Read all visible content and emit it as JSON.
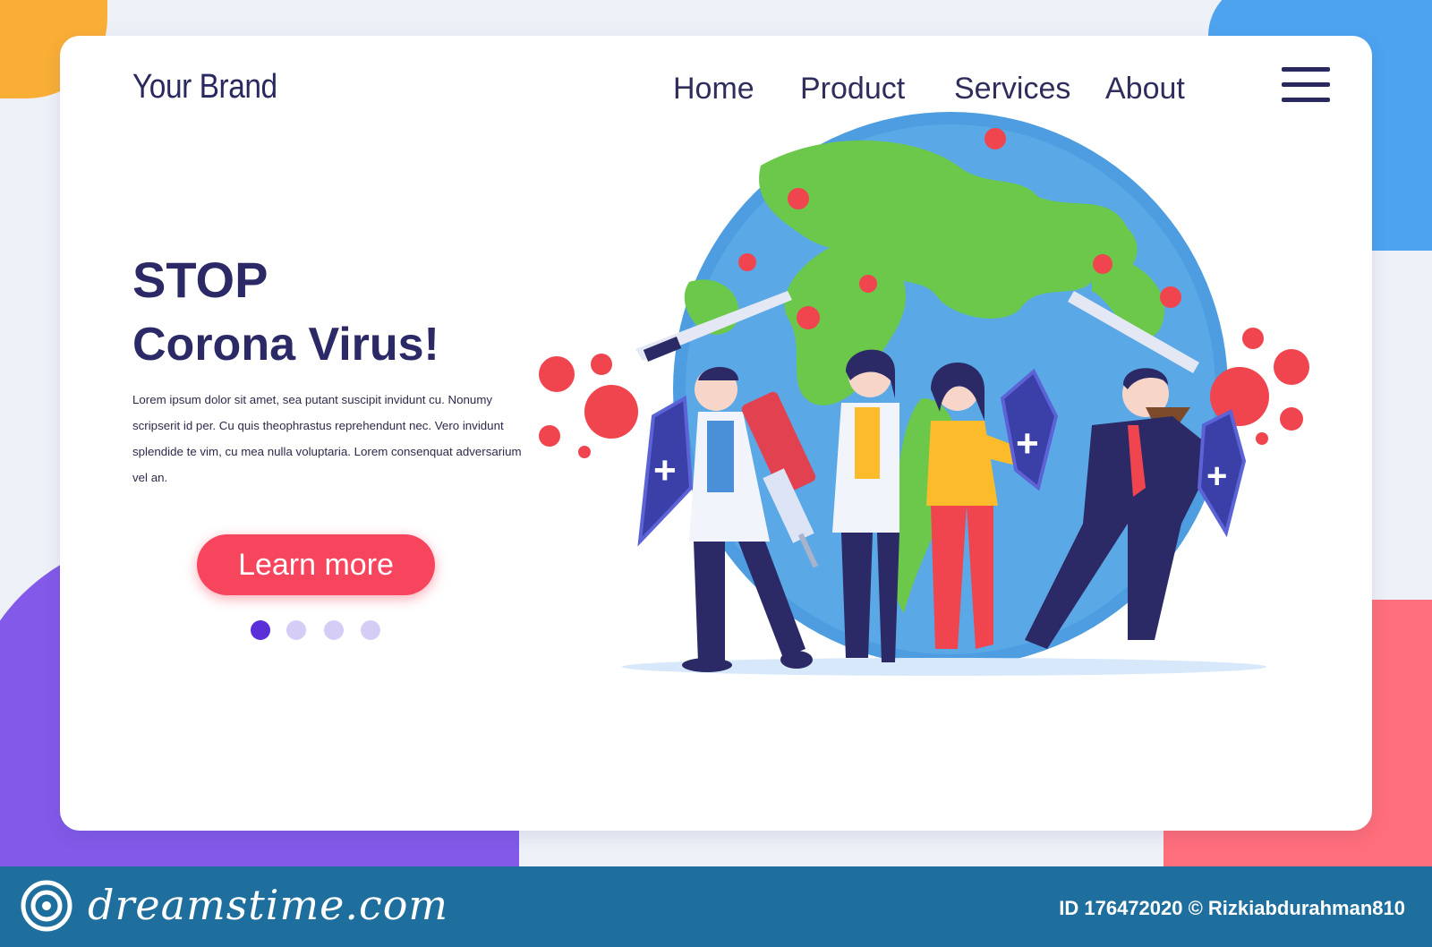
{
  "brand": "Your Brand",
  "nav": {
    "items": [
      {
        "label": "Home"
      },
      {
        "label": "Product"
      },
      {
        "label": "Services"
      },
      {
        "label": "About"
      }
    ]
  },
  "hero": {
    "title_line1": "STOP",
    "title_line2": "Corona Virus!",
    "body": "Lorem ipsum dolor sit amet, sea putant suscipit invidunt cu. Nonumy scripserit id per. Cu quis theophrastus reprehendunt nec. Vero invidunt splendide te vim, cu mea nulla voluptaria. Lorem consenquat adversarium vel an.",
    "cta_label": "Learn more"
  },
  "carousel": {
    "count": 4,
    "active_index": 0
  },
  "watermark": {
    "site": "dreamstime.com",
    "id_text": "ID 176472020 © Rizkiabdurahman810"
  },
  "colors": {
    "accent": "#f7455e",
    "brand_dark": "#2c2a66",
    "globe_ocean": "#5aa9e6",
    "globe_land": "#6cc84a",
    "virus": "#f0444e",
    "footer": "#1f6f9e"
  },
  "icons": [
    "hamburger-menu-icon",
    "dreamstime-logo-icon",
    "globe-icon",
    "virus-icon",
    "shield-cross-icon",
    "sword-icon",
    "syringe-icon"
  ]
}
